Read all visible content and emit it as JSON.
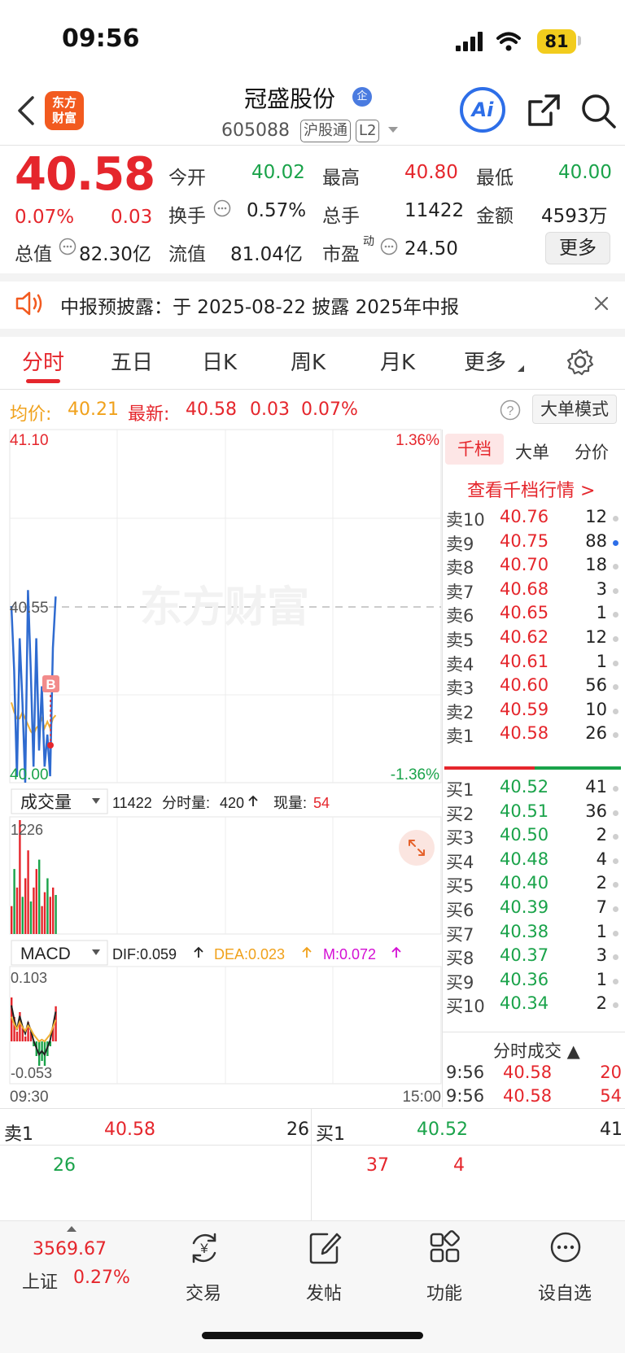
{
  "status_bar": {
    "time": "09:56",
    "battery": "81"
  },
  "header": {
    "logo": "东方\n财富",
    "stock_name": "冠盛股份",
    "corp_badge": "企",
    "stock_code": "605088",
    "tag_hgt": "沪股通",
    "tag_level": "L2",
    "ai_label": "Ai"
  },
  "quote": {
    "price": "40.58",
    "change_pct": "0.07%",
    "change": "0.03",
    "open_label": "今开",
    "open": "40.02",
    "high_label": "最高",
    "high": "40.80",
    "low_label": "最低",
    "low": "40.00",
    "turnover_label": "换手",
    "turnover": "0.57%",
    "volume_label": "总手",
    "volume": "11422",
    "amount_label": "金额",
    "amount": "4593万",
    "mktcap_label": "总值",
    "mktcap": "82.30亿",
    "float_label": "流值",
    "float_cap": "81.04亿",
    "pe_label": "市盈",
    "pe_sup": "动",
    "pe": "24.50",
    "more_label": "更多"
  },
  "notice": {
    "text": "中报预披露：于 2025-08-22 披露 2025年中报"
  },
  "tabs": [
    "分时",
    "五日",
    "日K",
    "周K",
    "月K",
    "更多"
  ],
  "chart_info": {
    "avg_label": "均价:",
    "avg": "40.21",
    "latest_label": "最新:",
    "latest": "40.58",
    "latest_change": "0.03",
    "latest_pct": "0.07%",
    "big_order_mode": "大单模式"
  },
  "chart_labels": {
    "y_top": "41.10",
    "y_mid": "40.55",
    "y_bottom": "40.00",
    "pct_top": "1.36%",
    "pct_bottom": "-1.36%",
    "watermark": "东方财富",
    "marker": "B",
    "vol_selector": "成交量",
    "vol_info_total": "11422",
    "vol_info_min_label": "分时量:",
    "vol_info_min": "420",
    "vol_info_now_label": "现量:",
    "vol_info_now": "54",
    "vol_max": "1226",
    "macd_selector": "MACD",
    "dif": "DIF:0.059",
    "dea": "DEA:0.023",
    "m": "M:0.072",
    "macd_top": "0.103",
    "macd_bottom": "-0.053",
    "time_start": "09:30",
    "time_end": "15:00"
  },
  "chart_data": {
    "type": "line",
    "title": "",
    "price_range": [
      40.0,
      41.1
    ],
    "prev_close": 40.55,
    "price_series_points": [
      40.55,
      40.35,
      40.02,
      40.45,
      40.25,
      40.0,
      40.6,
      40.35,
      40.05,
      40.45,
      40.1,
      40.3,
      40.05,
      40.15,
      40.02,
      40.42,
      40.58
    ],
    "avg_series_points": [
      40.25,
      40.22,
      40.2,
      40.2,
      40.22,
      40.2,
      40.18,
      40.16,
      40.15,
      40.17,
      40.18,
      40.2,
      40.17,
      40.19,
      40.17,
      40.2,
      40.21
    ],
    "volume_series_points": [
      300,
      700,
      500,
      1226,
      400,
      600,
      900,
      350,
      500,
      700,
      800,
      300,
      450,
      600,
      400,
      500,
      420
    ],
    "macd_series_points": [
      0.09,
      0.05,
      0.02,
      0.06,
      0.03,
      0.01,
      0.04,
      0.02,
      -0.01,
      -0.03,
      -0.05,
      -0.04,
      -0.05,
      -0.03,
      -0.01,
      0.03,
      0.072
    ]
  },
  "order_book": {
    "tabs": [
      "千档",
      "大单",
      "分价"
    ],
    "link": "查看千档行情 >",
    "asks": [
      {
        "label": "卖10",
        "price": "40.76",
        "vol": "12"
      },
      {
        "label": "卖9",
        "price": "40.75",
        "vol": "88"
      },
      {
        "label": "卖8",
        "price": "40.70",
        "vol": "18"
      },
      {
        "label": "卖7",
        "price": "40.68",
        "vol": "3"
      },
      {
        "label": "卖6",
        "price": "40.65",
        "vol": "1"
      },
      {
        "label": "卖5",
        "price": "40.62",
        "vol": "12"
      },
      {
        "label": "卖4",
        "price": "40.61",
        "vol": "1"
      },
      {
        "label": "卖3",
        "price": "40.60",
        "vol": "56"
      },
      {
        "label": "卖2",
        "price": "40.59",
        "vol": "10"
      },
      {
        "label": "卖1",
        "price": "40.58",
        "vol": "26"
      }
    ],
    "bids": [
      {
        "label": "买1",
        "price": "40.52",
        "vol": "41"
      },
      {
        "label": "买2",
        "price": "40.51",
        "vol": "36"
      },
      {
        "label": "买3",
        "price": "40.50",
        "vol": "2"
      },
      {
        "label": "买4",
        "price": "40.48",
        "vol": "4"
      },
      {
        "label": "买5",
        "price": "40.40",
        "vol": "2"
      },
      {
        "label": "买6",
        "price": "40.39",
        "vol": "7"
      },
      {
        "label": "买7",
        "price": "40.38",
        "vol": "1"
      },
      {
        "label": "买8",
        "price": "40.37",
        "vol": "3"
      },
      {
        "label": "买9",
        "price": "40.36",
        "vol": "1"
      },
      {
        "label": "买10",
        "price": "40.34",
        "vol": "2"
      }
    ],
    "ticks_title": "分时成交 ▲",
    "ticks": [
      {
        "time": "9:56",
        "price": "40.58",
        "vol": "20"
      },
      {
        "time": "9:56",
        "price": "40.58",
        "vol": "54"
      }
    ]
  },
  "bid_ask_bar": {
    "sell_label": "卖1",
    "sell_price": "40.58",
    "sell_vol": "26",
    "sell_detail": "26",
    "buy_label": "买1",
    "buy_price": "40.52",
    "buy_vol": "41",
    "buy_detail_1": "37",
    "buy_detail_2": "4"
  },
  "bottom_nav": {
    "index_value": "3569.67",
    "index_name": "上证",
    "index_pct": "0.27%",
    "trade": "交易",
    "post": "发帖",
    "functions": "功能",
    "watchlist": "设自选"
  }
}
